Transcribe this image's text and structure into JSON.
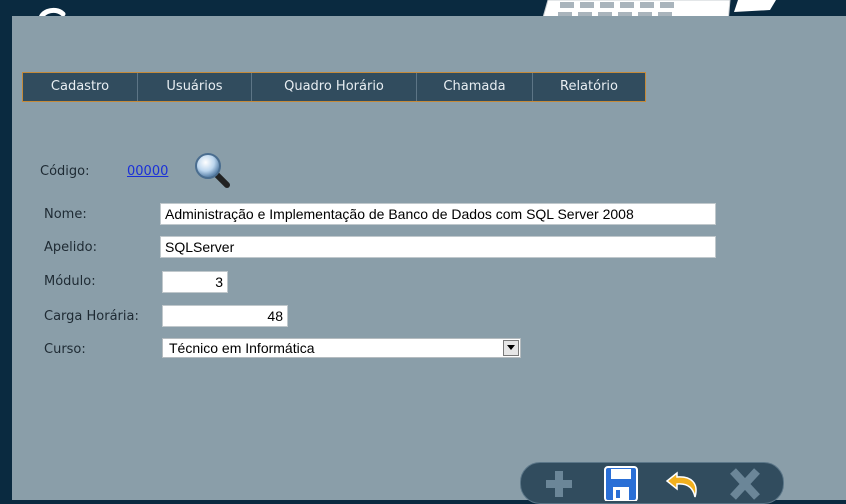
{
  "menu": {
    "items": [
      {
        "label": "Cadastro"
      },
      {
        "label": "Usuários"
      },
      {
        "label": "Quadro Horário"
      },
      {
        "label": "Chamada"
      },
      {
        "label": "Relatório"
      }
    ]
  },
  "form": {
    "codigo_label": "Código:",
    "codigo_value": "00000",
    "nome_label": "Nome:",
    "nome_value": "Administração e Implementação de Banco de Dados com SQL Server 2008",
    "apelido_label": "Apelido:",
    "apelido_value": "SQLServer",
    "modulo_label": "Módulo:",
    "modulo_value": "3",
    "carga_label": "Carga Horária:",
    "carga_value": "48",
    "curso_label": "Curso:",
    "curso_value": "Técnico em Informática"
  },
  "toolbar": {
    "add": "plus-icon",
    "save": "floppy-disk-icon",
    "undo": "undo-arrow-icon",
    "delete": "close-x-icon"
  },
  "colors": {
    "background": "#8a9ea9",
    "header": "#0a2a40",
    "menu": "#314c5e",
    "menu_border": "#c48a3a",
    "link": "#1a30d8"
  }
}
